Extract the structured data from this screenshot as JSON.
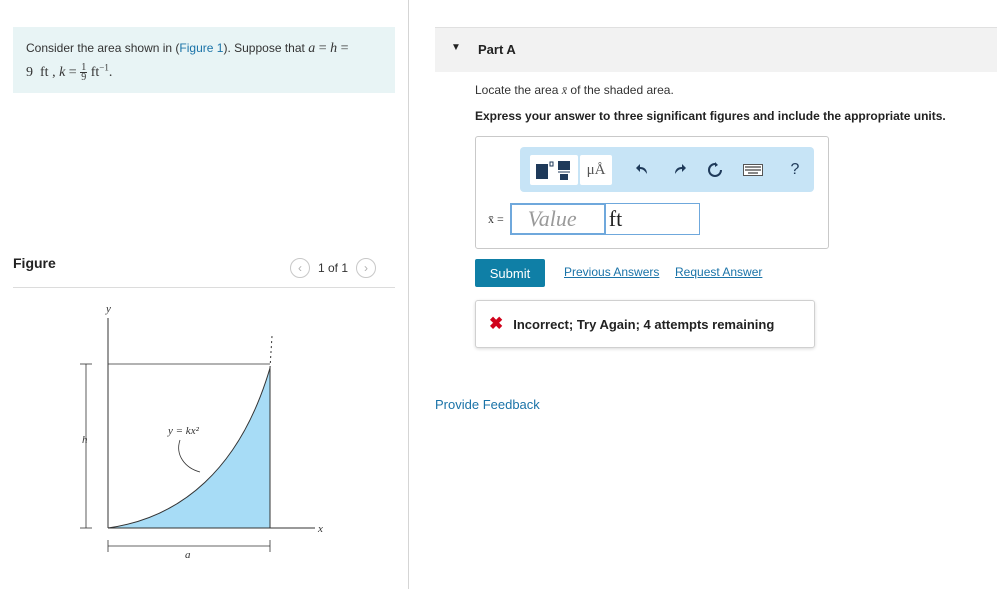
{
  "problem": {
    "text_before_link": "Consider the area shown in (",
    "figure_link": "Figure 1",
    "text_after_link": "). Suppose that ",
    "math_a": "a",
    "math_eq": " = ",
    "math_h": "h",
    "math_eq2": " =",
    "math_line2_value": "9",
    "math_ft": "ft",
    "math_comma": ",",
    "math_k": "k",
    "frac_num": "1",
    "frac_den": "9",
    "math_ft2": "ft",
    "exponent": "−1",
    "period": "."
  },
  "figure": {
    "title": "Figure",
    "pager_text": "1 of 1",
    "prev_icon": "chevron-left-icon",
    "next_icon": "chevron-right-icon",
    "label_y": "y",
    "label_x": "x",
    "label_h": "h",
    "label_a": "a",
    "curve_label": "y = kx²",
    "fill_color": "#a7dcf6"
  },
  "part": {
    "label": "Part A",
    "prompt_before": "Locate the area ",
    "prompt_var": "x̄",
    "prompt_after": " of the shaded area.",
    "instruction": "Express your answer to three significant figures and include the appropriate units."
  },
  "toolbar": {
    "template_icon": "templates-icon",
    "units_label": "μÅ",
    "undo_icon": "undo-icon",
    "redo_icon": "redo-icon",
    "reset_icon": "reset-icon",
    "keyboard_icon": "keyboard-icon",
    "help_label": "?",
    "accent": "#c7e4f6"
  },
  "answer": {
    "var_label": "x̄ =",
    "value_placeholder": "Value",
    "unit_value": "ft"
  },
  "actions": {
    "submit": "Submit",
    "previous_answers": "Previous Answers",
    "request_answer": "Request Answer"
  },
  "feedback": {
    "icon": "x-icon",
    "message": "Incorrect; Try Again; 4 attempts remaining"
  },
  "footer": {
    "provide_feedback": "Provide Feedback"
  }
}
